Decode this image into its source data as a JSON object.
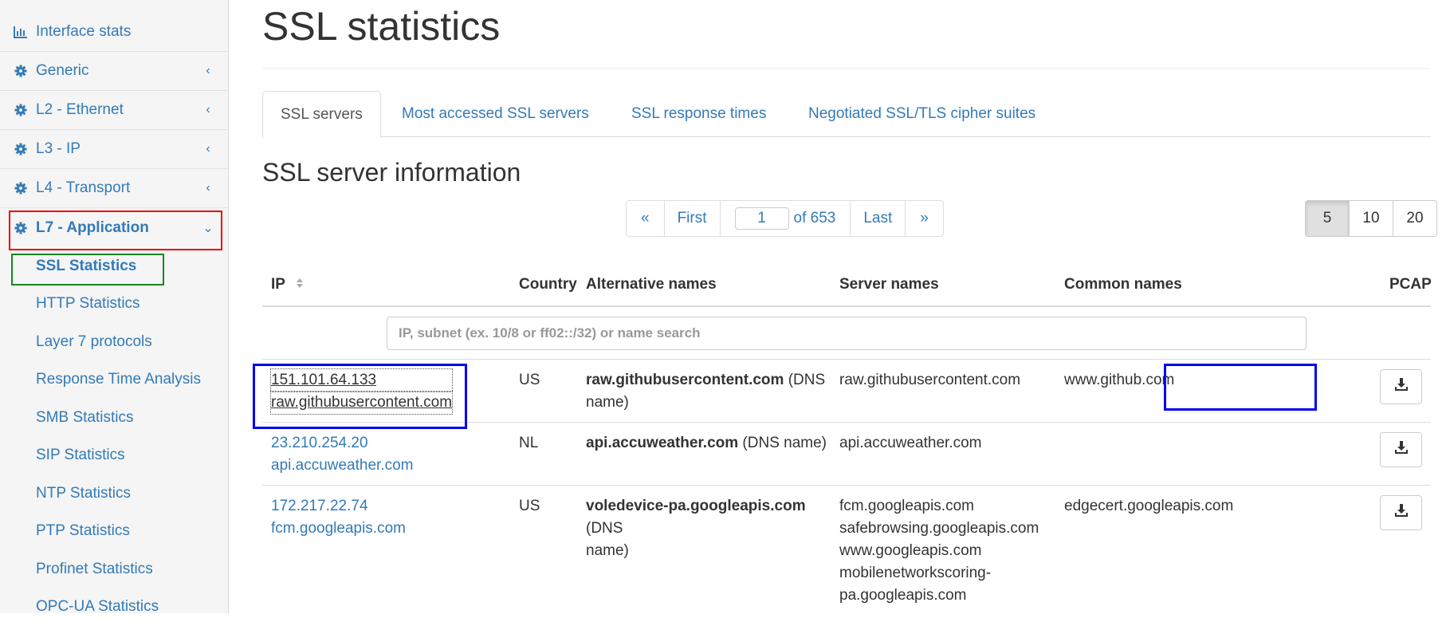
{
  "sidebar": {
    "top_item": {
      "label": "Interface stats",
      "icon": "bar-chart-icon"
    },
    "groups": [
      {
        "label": "Generic",
        "icon": "gear-icon",
        "chevron": "‹"
      },
      {
        "label": "L2 - Ethernet",
        "icon": "gear-icon",
        "chevron": "‹"
      },
      {
        "label": "L3 - IP",
        "icon": "gear-icon",
        "chevron": "‹"
      },
      {
        "label": "L4 - Transport",
        "icon": "gear-icon",
        "chevron": "‹"
      },
      {
        "label": "L7 - Application",
        "icon": "gear-icon",
        "chevron": "⌄",
        "expanded": true
      }
    ],
    "sub_items": [
      {
        "label": "SSL Statistics",
        "active": true
      },
      {
        "label": "HTTP Statistics"
      },
      {
        "label": "Layer 7 protocols"
      },
      {
        "label": "Response Time Analysis"
      },
      {
        "label": "SMB Statistics"
      },
      {
        "label": "SIP Statistics"
      },
      {
        "label": "NTP Statistics"
      },
      {
        "label": "PTP Statistics"
      },
      {
        "label": "Profinet Statistics"
      },
      {
        "label": "OPC-UA Statistics"
      }
    ]
  },
  "page": {
    "title": "SSL statistics",
    "tabs": [
      {
        "label": "SSL servers",
        "active": true
      },
      {
        "label": "Most accessed SSL servers"
      },
      {
        "label": "SSL response times"
      },
      {
        "label": "Negotiated SSL/TLS cipher suites"
      }
    ],
    "section_title": "SSL server information"
  },
  "pagination": {
    "prev": "«",
    "first": "First",
    "current_page": "1",
    "of_text": "of 653",
    "last": "Last",
    "next": "»"
  },
  "per_page": {
    "options": [
      "5",
      "10",
      "20"
    ],
    "selected": "5"
  },
  "table": {
    "columns": [
      "IP",
      "Country",
      "Alternative names",
      "Server names",
      "Common names",
      "PCAP"
    ],
    "filter_placeholder": "IP, subnet (ex. 10/8 or ff02::/32) or name search",
    "rows": [
      {
        "ip": "151.101.64.133",
        "host": "raw.githubusercontent.com",
        "country": "US",
        "alt_name": "raw.githubusercontent.com",
        "alt_suffix_1": " (DNS",
        "alt_suffix_2": "name)",
        "server_names": [
          "raw.githubusercontent.com"
        ],
        "common_names": [
          "www.github.com"
        ],
        "pcap_icon": "download-icon"
      },
      {
        "ip": "23.210.254.20",
        "host": "api.accuweather.com",
        "country": "NL",
        "alt_name": "api.accuweather.com",
        "alt_suffix_1": " (DNS name)",
        "alt_suffix_2": "",
        "server_names": [
          "api.accuweather.com"
        ],
        "common_names": [],
        "pcap_icon": "download-icon"
      },
      {
        "ip": "172.217.22.74",
        "host": "fcm.googleapis.com",
        "country": "US",
        "alt_name": "voledevice-pa.googleapis.com",
        "alt_suffix_1": " (DNS",
        "alt_suffix_2": "name)",
        "server_names": [
          "fcm.googleapis.com",
          "safebrowsing.googleapis.com",
          "www.googleapis.com",
          "mobilenetworkscoring-",
          "pa.googleapis.com"
        ],
        "common_names": [
          "edgecert.googleapis.com"
        ],
        "pcap_icon": "download-icon"
      }
    ]
  },
  "colors": {
    "link": "#337ab7",
    "highlight_red": "#ee0000",
    "highlight_green": "#14871e",
    "highlight_blue": "#0000ee"
  }
}
